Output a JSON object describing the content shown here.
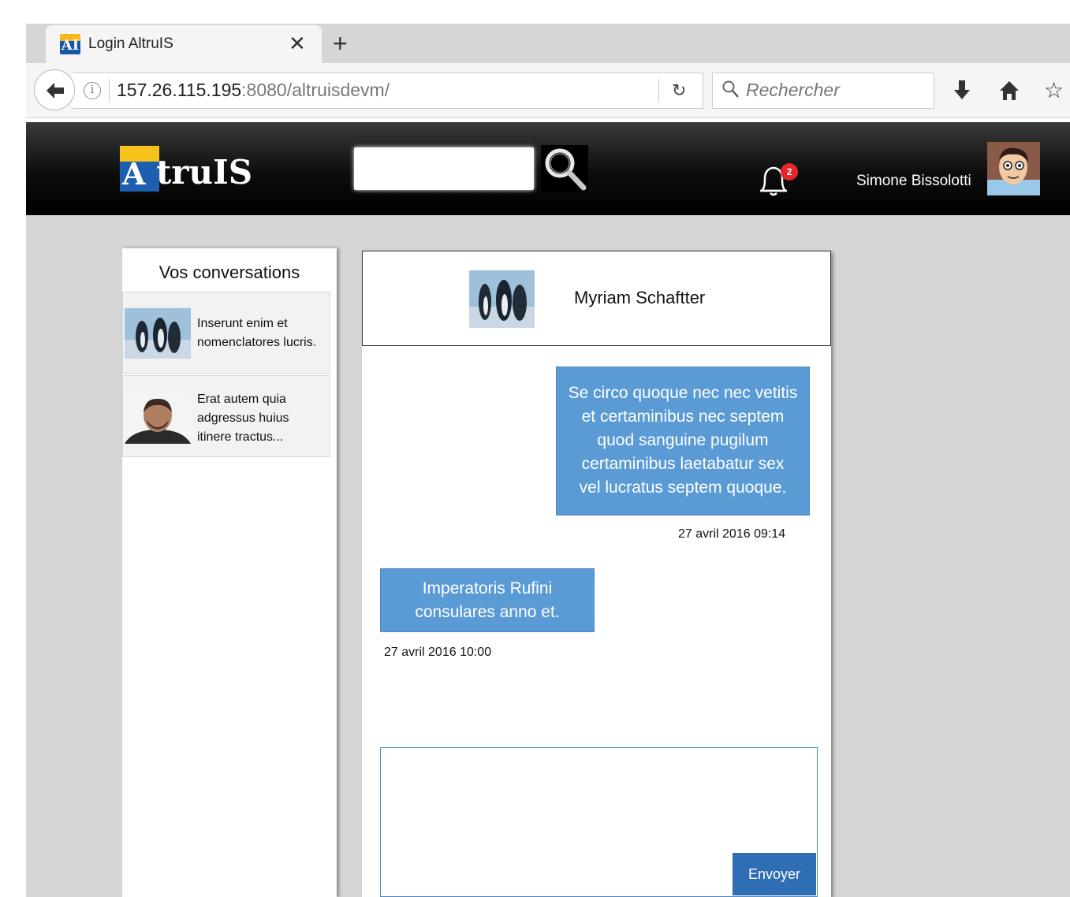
{
  "browser": {
    "tab_title": "Login AltruIS",
    "tab_logo_letters": "AI",
    "url_host": "157.26.115.195",
    "url_rest": ":8080/altruisdevm/",
    "search_placeholder": "Rechercher"
  },
  "app": {
    "logo_letter": "A",
    "logo_rest": "truIS",
    "notification_count": "2",
    "user_name": "Simone Bissolotti"
  },
  "conversations": {
    "title": "Vos conversations",
    "items": [
      {
        "line1": "Inserunt enim et",
        "line2": "nomenclatores lucris.",
        "line3": ""
      },
      {
        "line1": "Erat autem quia",
        "line2": "adgressus huius",
        "line3": "itinere tractus..."
      }
    ]
  },
  "chat": {
    "contact_name": "Myriam Schaftter",
    "messages": [
      {
        "text_lines": [
          "Se circo quoque nec nec vetitis",
          "et certaminibus nec septem",
          "quod sanguine pugilum",
          "certaminibus laetabatur sex",
          "vel lucratus septem quoque."
        ],
        "time": "27 avril 2016 09:14",
        "sender": "self"
      },
      {
        "text_lines": [
          "Imperatoris Rufini",
          "consulares anno et."
        ],
        "time": "27 avril 2016 10:00",
        "sender": "contact"
      }
    ],
    "send_label": "Envoyer",
    "reply_value": ""
  },
  "colors": {
    "bubble": "#5b9bd5",
    "send_button": "#2f6db4",
    "badge": "#e4262b",
    "logo_blue": "#1d5fae",
    "logo_yellow": "#f5c21b"
  }
}
